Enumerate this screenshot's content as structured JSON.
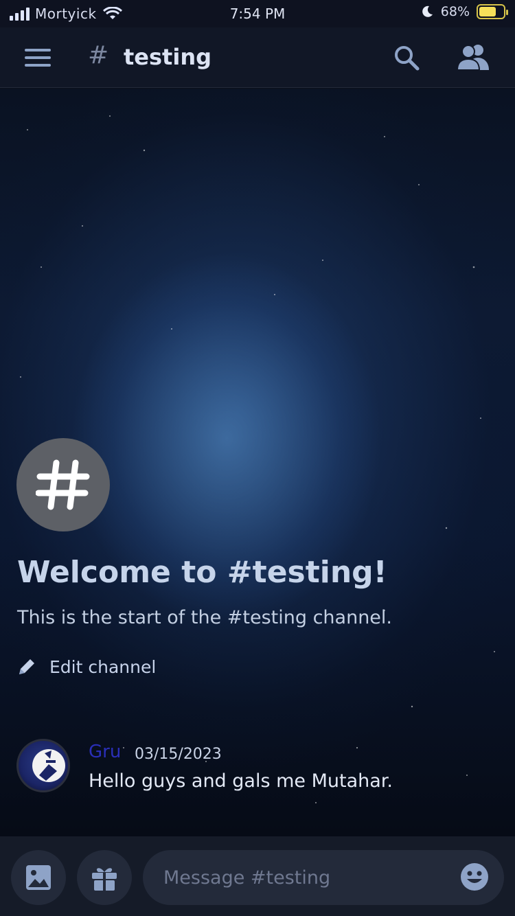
{
  "status_bar": {
    "carrier": "Mortyick",
    "time": "7:54 PM",
    "battery_percent": "68%",
    "battery_level": 0.68,
    "icons": [
      "signal-icon",
      "wifi-icon",
      "moon-icon",
      "battery-icon"
    ]
  },
  "header": {
    "hash": "#",
    "channel_name": "testing",
    "icons": [
      "hamburger-menu-icon",
      "search-icon",
      "members-icon"
    ]
  },
  "welcome": {
    "channel_glyph": "#",
    "title": "Welcome to #testing!",
    "subtitle": "This is the start of the #testing channel.",
    "edit_label": "Edit channel"
  },
  "messages": [
    {
      "author": "Gru",
      "timestamp": "03/15/2023",
      "text": "Hello guys and gals me Mutahar.",
      "author_color": "#2a2fb8"
    }
  ],
  "composer": {
    "placeholder": "Message #testing",
    "icons": [
      "image-icon",
      "gift-icon",
      "emoji-icon"
    ]
  },
  "colors": {
    "header_bg": "#111726",
    "accent": "#8ea3c7",
    "composer_bg": "#151b28"
  }
}
